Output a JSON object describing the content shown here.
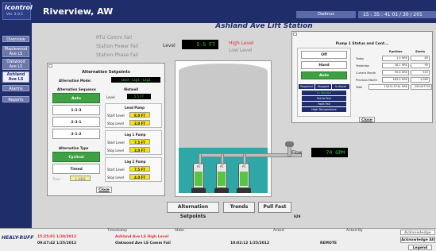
{
  "app": {
    "logo": "icontrol",
    "version": "Ver. 2.0.1",
    "site": "Riverview, AW",
    "station": "Ashland Ave Lift Station",
    "user": "Dadmus",
    "clock": "15 : 35 : 41  01 / 30 / 201"
  },
  "sidebar": {
    "items": [
      {
        "label": "Overview"
      },
      {
        "label": "Maplewood Ave LS"
      },
      {
        "label": "Oakwood Ave LS"
      },
      {
        "label": "Ashland Ave LS"
      },
      {
        "label": "Alarms"
      },
      {
        "label": "Reports"
      }
    ]
  },
  "status": {
    "rtu_comm_fail": "RTU Comm Fail",
    "station_power_fail": "Station Power Fail",
    "station_phase_fail": "Station Phase Fail",
    "level_label": "Level",
    "level_value": "5.5 FT",
    "high_level": "High Level",
    "low_level": "Low Level",
    "flow_label": "Flow",
    "flow_value": "70 GPM"
  },
  "buttons": {
    "alternation": "Alternation Setpoints",
    "trends": "Trends",
    "pull_fast": "Pull Fast",
    "num": "929"
  },
  "alternation": {
    "title": "Alternation Setpoints",
    "mode_label": "Alternation Mode:",
    "mode_value": "Lead - Lag1 - Lag2",
    "sequence_label": "Alternation Sequence",
    "sequences": [
      "Auto",
      "1-2-3",
      "2-3-1",
      "3-1-2"
    ],
    "type_label": "Alternation Type",
    "types": [
      "Cyclical",
      "Timed"
    ],
    "time_label": "Time",
    "time_value": "1 HRS",
    "wetwell_label": "Wetwell",
    "wetwell_level_label": "Level",
    "wetwell_level_value": "5.5 FT",
    "lead_pump": {
      "title": "Lead Pump",
      "start_label": "Start Level",
      "start": "8.0 FT",
      "stop_label": "Stop Level",
      "stop": "3.0 FT"
    },
    "lag1_pump": {
      "title": "Lag 1 Pump",
      "start_label": "Start Level",
      "start": "7.5 FT",
      "stop_label": "Stop Level",
      "stop": "3.0 FT"
    },
    "lag2_pump": {
      "title": "Lag 2 Pump",
      "start_label": "Start Level",
      "start": "7.5 FT",
      "stop_label": "Stop Level",
      "stop": "4.0 FT"
    },
    "close": "Close"
  },
  "pump_status": {
    "title": "Pump 1 Status and Cont...",
    "modes": [
      "Off",
      "Hand",
      "Auto"
    ],
    "tags": [
      "Required",
      "Stopped",
      "In Alarm"
    ],
    "states": [
      "In Service",
      "Fail to Run",
      "Fault Fail",
      "High Temperature"
    ],
    "col1": "Runtime",
    "col2": "Starts",
    "rows": [
      {
        "label": "Today",
        "runtime": "1.5 HRS",
        "starts": "85"
      },
      {
        "label": "Yesterday",
        "runtime": "18.1 HRS",
        "starts": "99"
      },
      {
        "label": "Current Month",
        "runtime": "90.6 HRS",
        "starts": "519"
      },
      {
        "label": "Previous Month",
        "runtime": "183.5 HRS",
        "starts": "1,089"
      },
      {
        "label": "Total",
        "runtime": "13415.5744 HRS",
        "starts": "295457759"
      }
    ],
    "close": "Close"
  },
  "pumps": [
    {
      "label": "P1"
    },
    {
      "label": "P2"
    },
    {
      "label": "P3"
    }
  ],
  "alarms": {
    "headers": [
      "Timestamp",
      "State",
      "Acked",
      "Acked By"
    ],
    "company": "HEALY-RUFF",
    "rows": [
      {
        "timestamp": "15:25:01 1/30/2012",
        "state": "Ashland Ave LS High Level",
        "acked": "",
        "acked_by": "",
        "color": "#e03333"
      },
      {
        "timestamp": "09:47:42 1/25/2012",
        "state": "Oakwood Ave LS Comm Fail",
        "acked": "10:02:12 1/25/2012",
        "acked_by": "REMOTE",
        "color": "#222222"
      }
    ],
    "ack_label": "Acknowledge",
    "ack_all": "Acknowledge All",
    "legend": "Legend"
  },
  "colors": {
    "navy": "#1f2d6b",
    "green_display": "#2dd62d",
    "alarm_red": "#e03333",
    "water": "#2fa7a7",
    "setpoint_yellow": "#f6e600"
  }
}
